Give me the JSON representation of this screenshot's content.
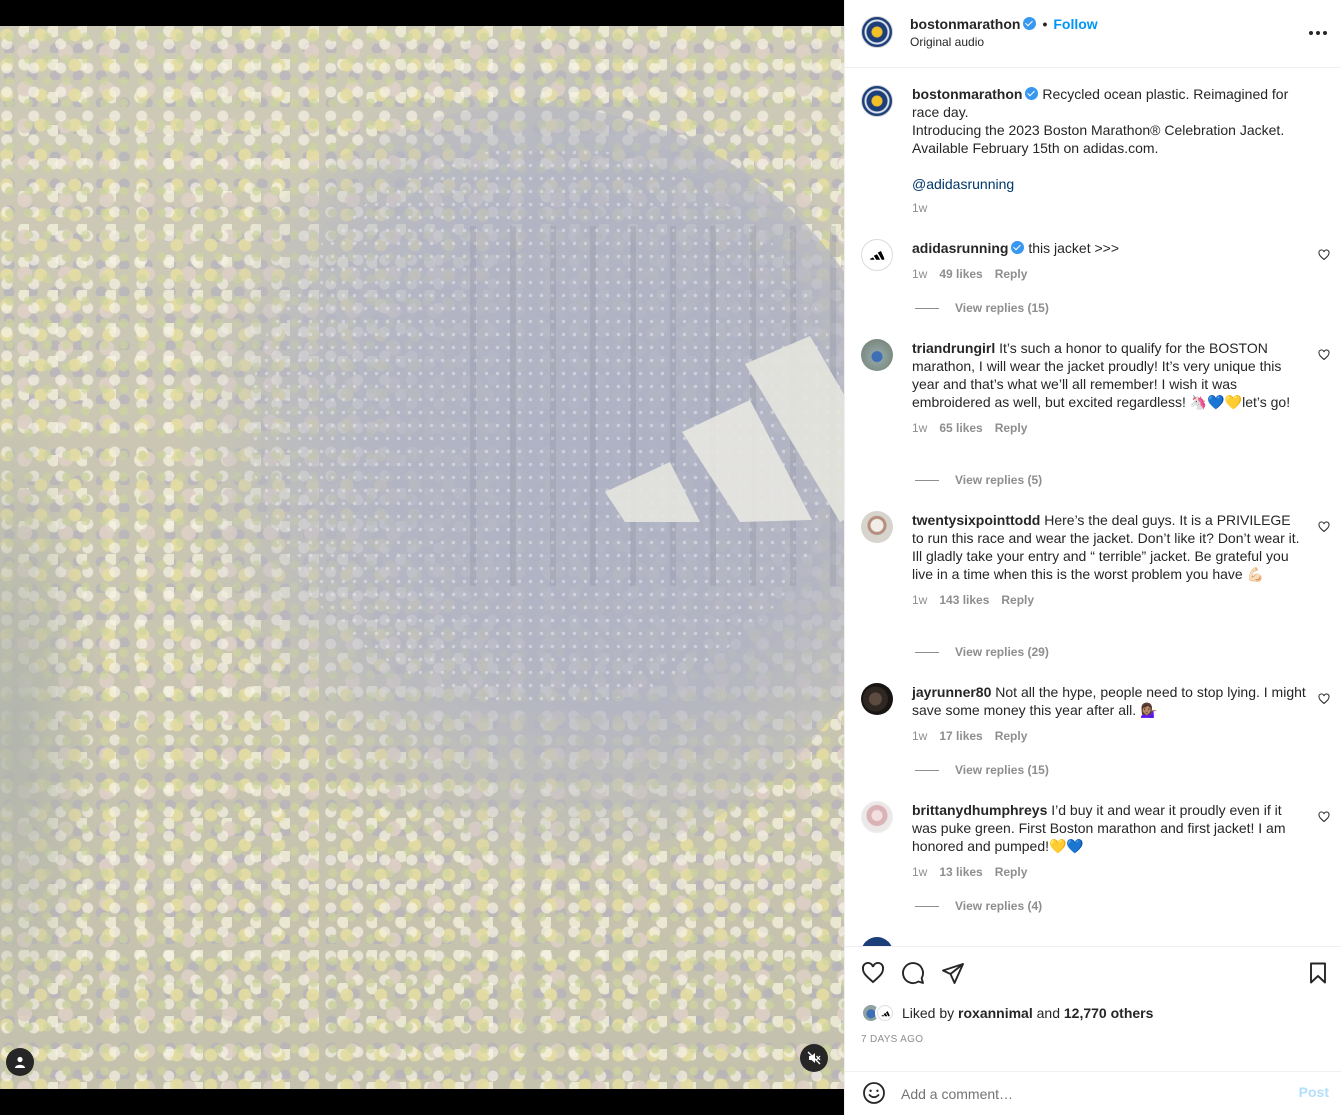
{
  "colors": {
    "accent": "#0095f6",
    "verified": "#3897f0",
    "link": "#00376b",
    "muted": "#8e8e8e",
    "text": "#262626",
    "post_disabled": "#b2dffc"
  },
  "media": {
    "profile_icon": "user-silhouette-icon",
    "mute_icon": "speaker-muted-icon"
  },
  "header": {
    "username": "bostonmarathon",
    "separator": "•",
    "follow_label": "Follow",
    "audio": "Original audio",
    "more_icon": "more-horizontal-icon"
  },
  "caption": {
    "username": "bostonmarathon",
    "line1": "Recycled ocean plastic. Reimagined for race day.",
    "line2": "Introducing the 2023 Boston Marathon® Celebration Jacket. Available February 15th on adidas.com.",
    "mention": "@adidasrunning",
    "time": "1w"
  },
  "comments": [
    {
      "username": "adidasrunning",
      "verified": true,
      "text": "this jacket >>>",
      "time": "1w",
      "likes": "49 likes",
      "reply_label": "Reply",
      "view_replies": "View replies (15)"
    },
    {
      "username": "triandrungirl",
      "verified": false,
      "text": "It’s such a honor to qualify for the BOSTON marathon, I will wear the jacket proudly! It’s very unique this year and that’s what we’ll all remember! I wish it was embroidered as well, but excited regardless! 🦄💙💛let’s go!",
      "time": "1w",
      "likes": "65 likes",
      "reply_label": "Reply",
      "view_replies": "View replies (5)"
    },
    {
      "username": "twentysixpointtodd",
      "verified": false,
      "text": "Here’s the deal guys. It is a PRIVILEGE to run this race and wear the jacket. Don’t like it? Don’t wear it. Ill gladly take your entry and “ terrible” jacket. Be grateful you live in a time when this is the worst problem you have 💪🏻",
      "time": "1w",
      "likes": "143 likes",
      "reply_label": "Reply",
      "view_replies": "View replies (29)"
    },
    {
      "username": "jayrunner80",
      "verified": false,
      "text": "Not all the hype, people need to stop lying. I might save some money this year after all. 💁🏽‍♀️",
      "time": "1w",
      "likes": "17 likes",
      "reply_label": "Reply",
      "view_replies": "View replies (15)"
    },
    {
      "username": "brittanydhumphreys",
      "verified": false,
      "text": "I’d buy it and wear it proudly even if it was puke green. First Boston marathon and first jacket! I am honored and pumped!💛💙",
      "time": "1w",
      "likes": "13 likes",
      "reply_label": "Reply",
      "view_replies": "View replies (4)"
    }
  ],
  "footer": {
    "like_icon": "heart-icon",
    "comment_icon": "comment-bubble-icon",
    "share_icon": "paper-plane-icon",
    "save_icon": "bookmark-icon",
    "liked_by_prefix": "Liked by",
    "liked_by_user": "roxannimal",
    "liked_by_and": "and",
    "liked_by_others": "12,770 others",
    "time_ago": "7 DAYS AGO",
    "emoji_icon": "smiley-face-icon",
    "comment_placeholder": "Add a comment…",
    "post_label": "Post"
  }
}
